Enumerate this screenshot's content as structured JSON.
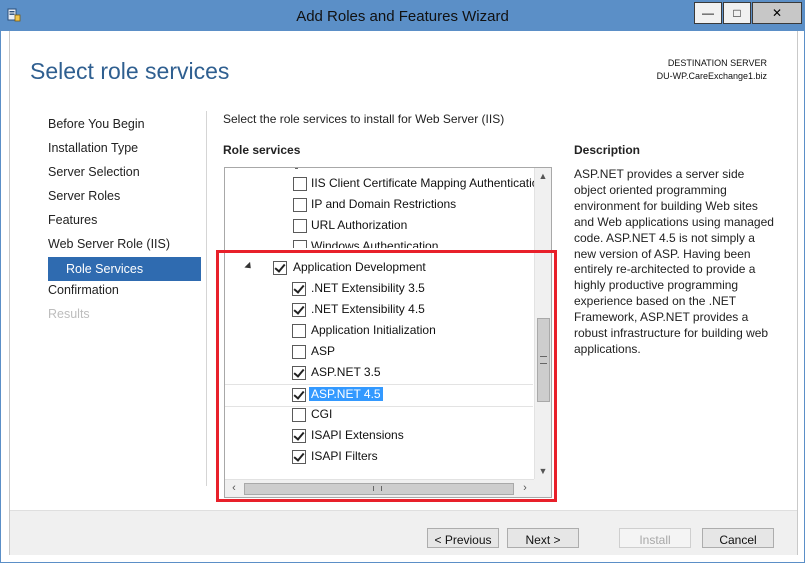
{
  "window": {
    "title": "Add Roles and Features Wizard",
    "controls": {
      "minimize": "—",
      "maximize": "□",
      "close": "✕"
    }
  },
  "header": {
    "page_title": "Select role services",
    "destination_label": "DESTINATION SERVER",
    "destination_server": "DU-WP.CareExchange1.biz"
  },
  "nav": {
    "items": [
      {
        "label": "Before You Begin",
        "state": "normal"
      },
      {
        "label": "Installation Type",
        "state": "normal"
      },
      {
        "label": "Server Selection",
        "state": "normal"
      },
      {
        "label": "Server Roles",
        "state": "normal"
      },
      {
        "label": "Features",
        "state": "normal"
      },
      {
        "label": "Web Server Role (IIS)",
        "state": "normal"
      },
      {
        "label": "Role Services",
        "state": "active"
      },
      {
        "label": "Confirmation",
        "state": "normal"
      },
      {
        "label": "Results",
        "state": "disabled"
      }
    ]
  },
  "main": {
    "instruction": "Select the role services to install for Web Server (IIS)",
    "role_services_label": "Role services",
    "items": [
      {
        "label": "IIS Client Certificate Mapping Authentication",
        "checked": false
      },
      {
        "label": "IP and Domain Restrictions",
        "checked": false
      },
      {
        "label": "URL Authorization",
        "checked": false
      },
      {
        "label": "Windows Authentication",
        "checked": false
      },
      {
        "label": "Application Development",
        "checked": true
      },
      {
        "label": ".NET Extensibility 3.5",
        "checked": true
      },
      {
        "label": ".NET Extensibility 4.5",
        "checked": true
      },
      {
        "label": "Application Initialization",
        "checked": false
      },
      {
        "label": "ASP",
        "checked": false
      },
      {
        "label": "ASP.NET 3.5",
        "checked": true
      },
      {
        "label": "ASP.NET 4.5",
        "checked": true,
        "selected": true
      },
      {
        "label": "CGI",
        "checked": false
      },
      {
        "label": "ISAPI Extensions",
        "checked": true
      },
      {
        "label": "ISAPI Filters",
        "checked": true
      }
    ]
  },
  "description": {
    "label": "Description",
    "text": "ASP.NET provides a server side object oriented programming environment for building Web sites and Web applications using managed code. ASP.NET 4.5 is not simply a new version of ASP. Having been entirely re-architected to provide a highly productive programming experience based on the .NET Framework, ASP.NET provides a robust infrastructure for building web applications."
  },
  "footer": {
    "previous": "< Previous",
    "next": "Next >",
    "install": "Install",
    "cancel": "Cancel"
  },
  "colors": {
    "titlebar": "#5b8fc7",
    "accent": "#2f6bb0",
    "selection": "#3399ff",
    "annotation_box": "#e8202a"
  }
}
